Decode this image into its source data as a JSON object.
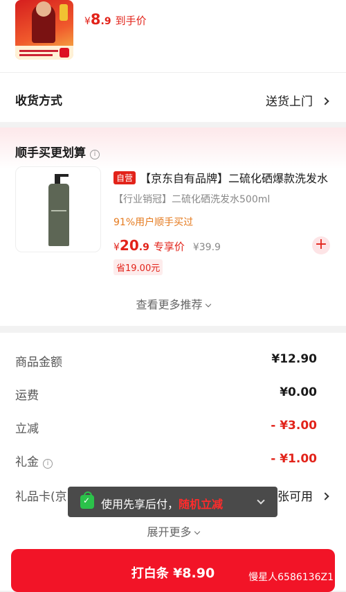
{
  "top_product": {
    "price_currency": "¥",
    "price_int": "8",
    "price_dec": ".9",
    "price_label": "到手价"
  },
  "delivery": {
    "title": "收货方式",
    "value": "送货上门"
  },
  "recommendation": {
    "heading": "顺手买更划算",
    "item": {
      "self_tag": "自营",
      "title": "【京东自有品牌】二硫化硒爆款洗发水",
      "subtitle": "【行业销冠】二硫化硒洗发水500ml",
      "percent_text": "91%用户顺手买过",
      "price_currency": "¥",
      "price_int": "20",
      "price_dec": ".9",
      "price_label": "专享价",
      "original_price": "¥39.9",
      "save_text": "省19.00元",
      "add_symbol": "+"
    },
    "more_label": "查看更多推荐"
  },
  "summary": {
    "rows": [
      {
        "label": "商品金额",
        "value": "¥12.90"
      },
      {
        "label": "运费",
        "value": "¥0.00"
      },
      {
        "label": "立减",
        "value": "- ¥3.00"
      },
      {
        "label": "礼金",
        "value": "- ¥1.00"
      }
    ],
    "gift_card": {
      "label": "礼品卡(京",
      "value": "张可用"
    },
    "expand_label": "展开更多"
  },
  "toast": {
    "text": "使用先享后付，",
    "highlight": "随机立减"
  },
  "pay_button": {
    "label": "打白条",
    "amount": "¥8.90"
  },
  "watermark": "慢星人6586136Z1",
  "colors": {
    "accent": "#e2231a",
    "pay_button": "#f21427",
    "toast_bg": "#3c3c3c",
    "orange": "#e57a1e"
  }
}
